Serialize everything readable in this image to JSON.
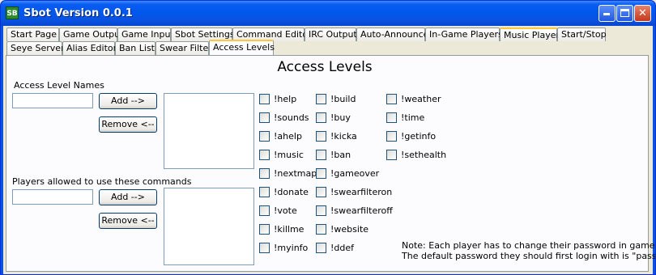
{
  "window": {
    "title": "Sbot Version 0.0.1",
    "icon": "app-icon",
    "icon_text": "SB"
  },
  "tabs_row1": [
    "Start Page",
    "Game Output",
    "Game Input",
    "Sbot Settings",
    "Command Editor",
    "IRC Output",
    "Auto-Announce",
    "In-Game Players",
    "Music Player",
    "Start/Stop"
  ],
  "tabs_row2": [
    "Seye Server",
    "Alias Editor",
    "Ban List",
    "Swear Filter",
    "Access Levels"
  ],
  "active_tab": "Access Levels",
  "page": {
    "heading": "Access Levels",
    "names_label": "Access Level Names",
    "names_input_value": "",
    "add_button": "Add -->",
    "remove_button": "Remove <--",
    "players_label": "Players allowed to use these commands",
    "players_input_value": "",
    "add_button_2": "Add -->",
    "remove_button_2": "Remove <--"
  },
  "commands": {
    "col1": [
      "!help",
      "!sounds",
      "!ahelp",
      "!music",
      "!nextmap",
      "!donate",
      "!vote",
      "!killme",
      "!myinfo"
    ],
    "col2": [
      "!build",
      "!buy",
      "!kicka",
      "!ban",
      "!gameover",
      "!swearfilteron",
      "!swearfilteroff",
      "!website",
      "!ddef"
    ],
    "col3": [
      "!weather",
      "!time",
      "!getinfo",
      "!sethealth"
    ]
  },
  "note": {
    "line1": "Note: Each player has to change their password in game.",
    "line2": "The default password they should first login with is \"password\""
  },
  "colors": {
    "titlebar": "#0A53E2",
    "window_bg": "#ECE9D8",
    "tab_highlight": "#FFC83C"
  }
}
